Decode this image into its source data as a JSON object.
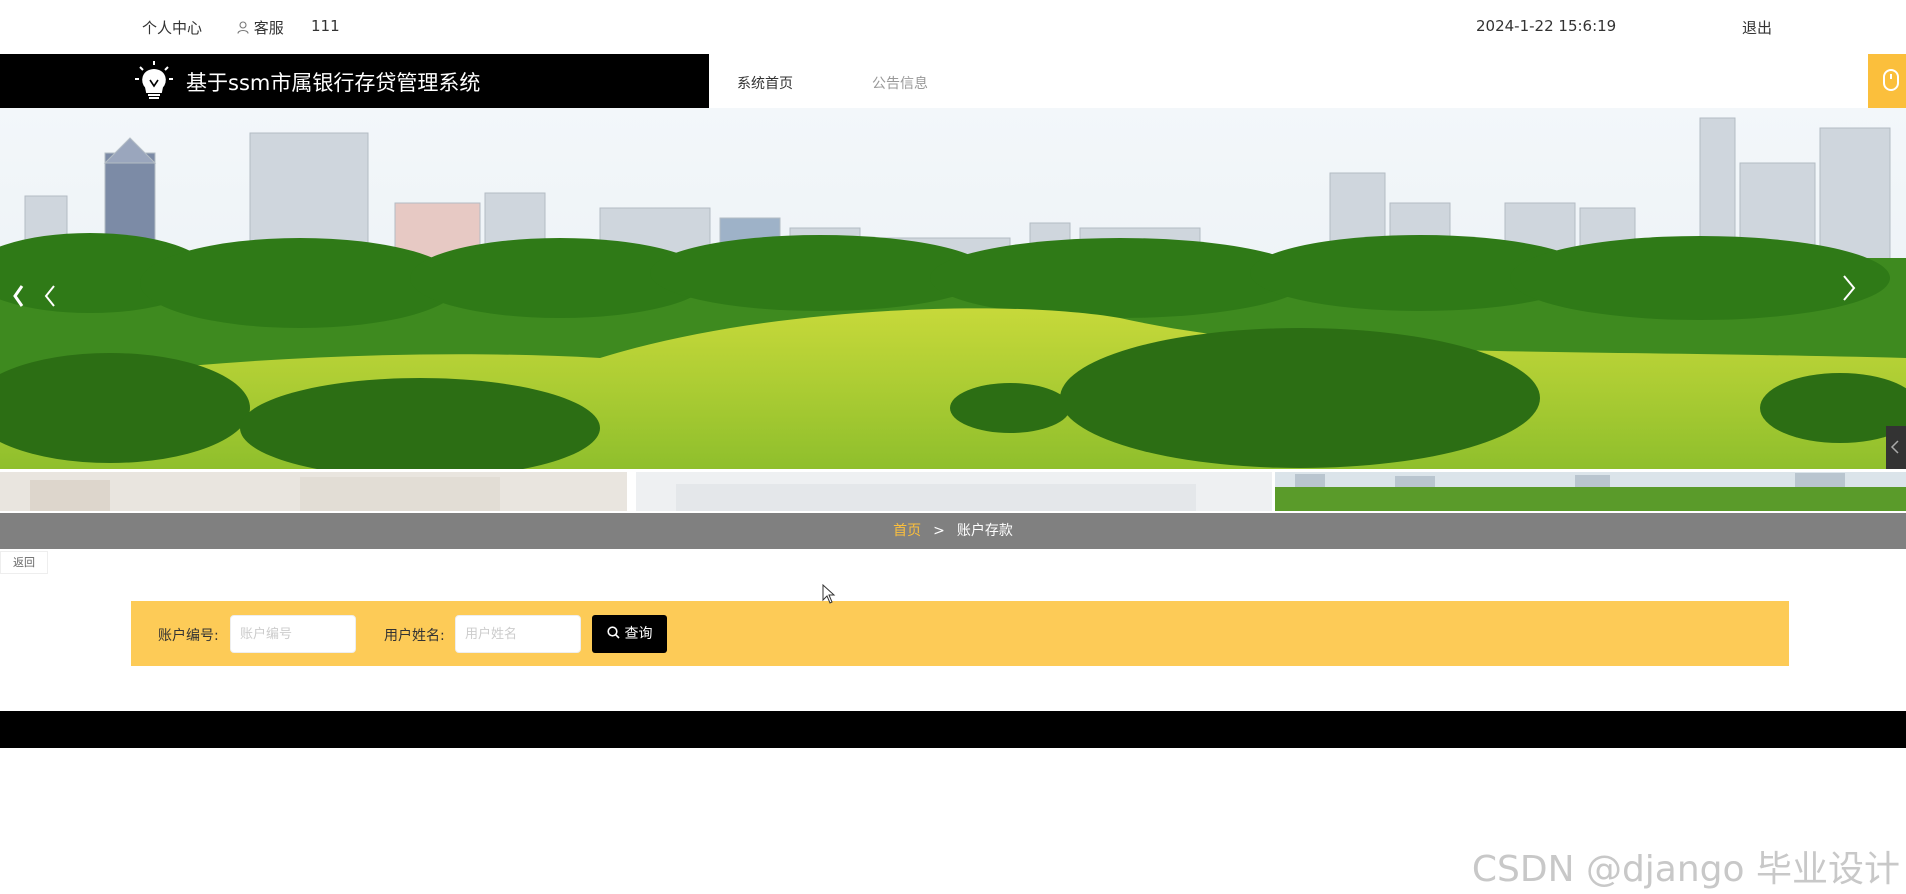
{
  "topbar": {
    "personal_center": "个人中心",
    "customer_service_label": "客服",
    "username": "111",
    "datetime": "2024-1-22 15:6:19",
    "logout": "退出"
  },
  "brand": {
    "title": "基于ssm市属银行存贷管理系统"
  },
  "nav": {
    "items": [
      {
        "label": "系统首页"
      },
      {
        "label": "公告信息"
      }
    ]
  },
  "breadcrumb": {
    "home": "首页",
    "separator": ">",
    "current": "账户存款"
  },
  "back_label": "返回",
  "search": {
    "account_no_label": "账户编号:",
    "account_no_placeholder": "账户编号",
    "account_no_value": "",
    "user_name_label": "用户姓名:",
    "user_name_placeholder": "用户姓名",
    "user_name_value": "",
    "query_button": "查询"
  },
  "watermark": "CSDN @django 毕业设计",
  "colors": {
    "accent": "#fdcb57",
    "crumb_home": "#fbbf3c",
    "crumb_bar": "#808080",
    "brand_bar": "#000000"
  },
  "icons": {
    "user": "user-icon",
    "logo": "lightbulb-logo-icon",
    "search": "search-icon",
    "prev": "chevron-left-icon",
    "next": "chevron-right-icon",
    "mouse": "mouse-icon"
  }
}
